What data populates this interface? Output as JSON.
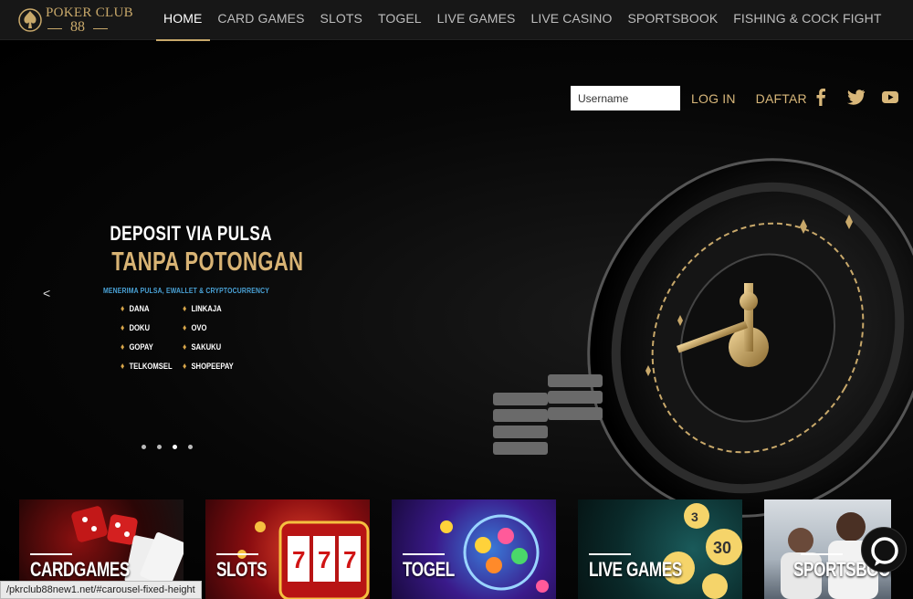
{
  "brand": {
    "name": "POKER CLUB",
    "number": "88"
  },
  "nav": [
    {
      "label": "HOME",
      "active": true
    },
    {
      "label": "CARD GAMES",
      "active": false
    },
    {
      "label": "SLOTS",
      "active": false
    },
    {
      "label": "TOGEL",
      "active": false
    },
    {
      "label": "LIVE GAMES",
      "active": false
    },
    {
      "label": "LIVE CASINO",
      "active": false
    },
    {
      "label": "SPORTSBOOK",
      "active": false
    },
    {
      "label": "FISHING & COCK FIGHT",
      "active": false
    }
  ],
  "login": {
    "username_placeholder": "Username",
    "login_label": "LOG IN",
    "register_label": "DAFTAR"
  },
  "social": [
    "facebook-icon",
    "twitter-icon",
    "youtube-icon"
  ],
  "carousel": {
    "prev": "<",
    "slide": {
      "line1": "DEPOSIT VIA PULSA",
      "line2": "TANPA POTONGAN",
      "subtitle": "MENERIMA PULSA, EWALLET & CRYPTOCURRENCY",
      "methods": [
        "DANA",
        "LINKAJA",
        "DOKU",
        "OVO",
        "GOPAY",
        "SAKUKU",
        "TELKOMSEL",
        "SHOPEEPAY"
      ]
    },
    "dot_count": 4,
    "active_dot": 3
  },
  "categories": [
    "CARDGAMES",
    "SLOTS",
    "TOGEL",
    "LIVE GAMES",
    "SPORTSBOOK"
  ],
  "status_url": "/pkrclub88new1.net/#carousel-fixed-height",
  "colors": {
    "gold": "#c8a86a",
    "accent_blue": "#4aa3d8",
    "nav_bg": "#171717"
  }
}
